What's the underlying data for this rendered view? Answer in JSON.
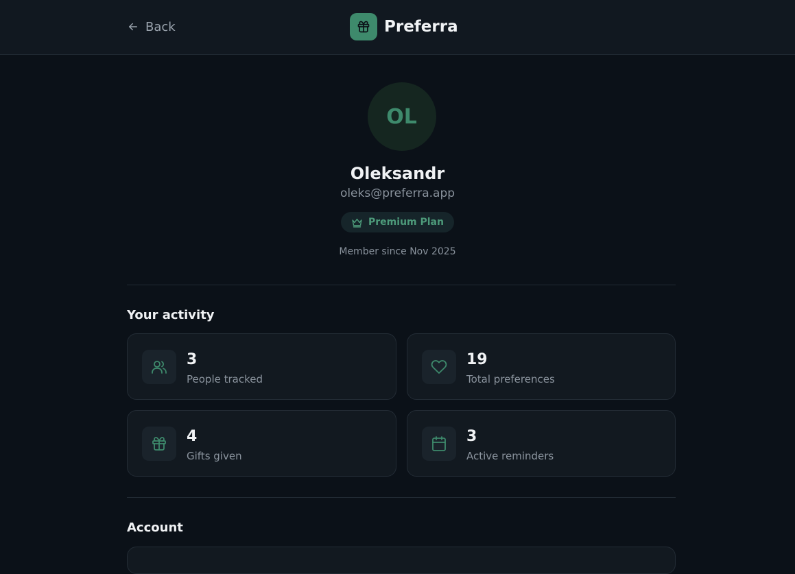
{
  "header": {
    "back_label": "Back",
    "brand_name": "Preferra",
    "brand_icon": "gift-icon"
  },
  "profile": {
    "initials": "OL",
    "name": "Oleksandr",
    "email": "oleks@preferra.app",
    "plan": "Premium Plan",
    "plan_icon": "crown-icon",
    "member_since": "Member since Nov 2025"
  },
  "activity": {
    "title": "Your activity",
    "stats": [
      {
        "value": "3",
        "label": "People tracked",
        "icon": "users-icon"
      },
      {
        "value": "19",
        "label": "Total preferences",
        "icon": "heart-icon"
      },
      {
        "value": "4",
        "label": "Gifts given",
        "icon": "gift-icon"
      },
      {
        "value": "3",
        "label": "Active reminders",
        "icon": "calendar-icon"
      }
    ]
  },
  "account": {
    "title": "Account"
  },
  "colors": {
    "accent": "#3e8a6c",
    "background": "#0b1118",
    "card": "#121920"
  }
}
